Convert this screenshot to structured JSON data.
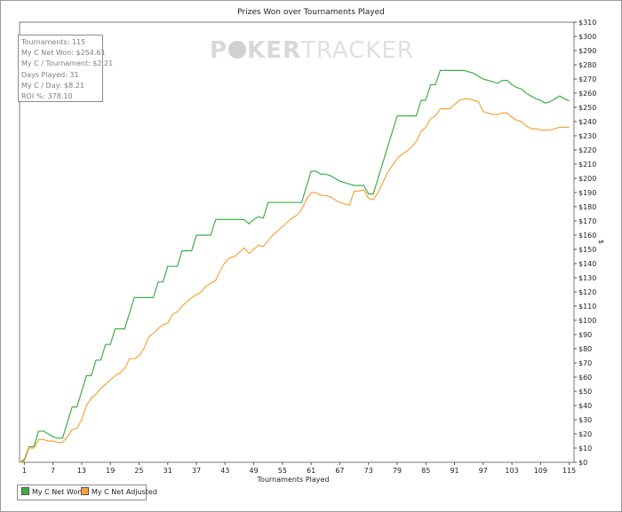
{
  "chart_data": {
    "type": "line",
    "title": "Prizes Won over Tournaments Played",
    "xlabel": "Tournaments Played",
    "ylabel": "$",
    "xlim": [
      0,
      116
    ],
    "ylim": [
      0,
      310
    ],
    "x_ticks": [
      1,
      7,
      13,
      19,
      25,
      31,
      37,
      43,
      49,
      55,
      61,
      67,
      73,
      79,
      85,
      91,
      97,
      103,
      109,
      115
    ],
    "y_ticks_step": 10,
    "y_tick_prefix": "$",
    "y_axis_side": "right",
    "grid": false,
    "legend_position": "bottom-left",
    "series": [
      {
        "name": "My C Net Won",
        "color": "#3fae49",
        "points": [
          [
            0,
            0
          ],
          [
            1,
            2
          ],
          [
            2,
            11
          ],
          [
            3,
            11
          ],
          [
            4,
            22
          ],
          [
            5,
            22
          ],
          [
            6,
            20
          ],
          [
            7,
            18
          ],
          [
            8,
            17
          ],
          [
            9,
            17
          ],
          [
            10,
            28
          ],
          [
            11,
            39
          ],
          [
            12,
            39
          ],
          [
            13,
            50
          ],
          [
            14,
            61
          ],
          [
            15,
            61
          ],
          [
            16,
            72
          ],
          [
            17,
            72
          ],
          [
            18,
            83
          ],
          [
            19,
            83
          ],
          [
            20,
            94
          ],
          [
            21,
            94
          ],
          [
            22,
            94
          ],
          [
            23,
            105
          ],
          [
            24,
            116
          ],
          [
            25,
            116
          ],
          [
            26,
            116
          ],
          [
            27,
            116
          ],
          [
            28,
            116
          ],
          [
            29,
            127
          ],
          [
            30,
            127
          ],
          [
            31,
            138
          ],
          [
            32,
            138
          ],
          [
            33,
            138
          ],
          [
            34,
            149
          ],
          [
            35,
            149
          ],
          [
            36,
            149
          ],
          [
            37,
            160
          ],
          [
            38,
            160
          ],
          [
            39,
            160
          ],
          [
            40,
            160
          ],
          [
            41,
            171
          ],
          [
            42,
            171
          ],
          [
            43,
            171
          ],
          [
            44,
            171
          ],
          [
            45,
            171
          ],
          [
            46,
            171
          ],
          [
            47,
            171
          ],
          [
            48,
            168
          ],
          [
            49,
            171
          ],
          [
            50,
            173
          ],
          [
            51,
            172
          ],
          [
            52,
            183
          ],
          [
            53,
            183
          ],
          [
            54,
            183
          ],
          [
            55,
            183
          ],
          [
            56,
            183
          ],
          [
            57,
            183
          ],
          [
            58,
            183
          ],
          [
            59,
            183
          ],
          [
            60,
            194
          ],
          [
            61,
            205
          ],
          [
            62,
            205
          ],
          [
            63,
            203
          ],
          [
            64,
            203
          ],
          [
            65,
            202
          ],
          [
            66,
            200
          ],
          [
            67,
            198
          ],
          [
            68,
            197
          ],
          [
            69,
            196
          ],
          [
            70,
            195
          ],
          [
            71,
            195
          ],
          [
            72,
            195
          ],
          [
            73,
            189
          ],
          [
            74,
            189
          ],
          [
            75,
            200
          ],
          [
            76,
            211
          ],
          [
            77,
            222
          ],
          [
            78,
            233
          ],
          [
            79,
            244
          ],
          [
            80,
            244
          ],
          [
            81,
            244
          ],
          [
            82,
            244
          ],
          [
            83,
            244
          ],
          [
            84,
            255
          ],
          [
            85,
            255
          ],
          [
            86,
            266
          ],
          [
            87,
            266
          ],
          [
            88,
            276
          ],
          [
            89,
            276
          ],
          [
            90,
            276
          ],
          [
            91,
            276
          ],
          [
            92,
            276
          ],
          [
            93,
            276
          ],
          [
            94,
            275
          ],
          [
            95,
            274
          ],
          [
            96,
            272
          ],
          [
            97,
            270
          ],
          [
            98,
            269
          ],
          [
            99,
            268
          ],
          [
            100,
            267
          ],
          [
            101,
            269
          ],
          [
            102,
            269
          ],
          [
            103,
            266
          ],
          [
            104,
            264
          ],
          [
            105,
            263
          ],
          [
            106,
            260
          ],
          [
            107,
            258
          ],
          [
            108,
            256
          ],
          [
            109,
            255
          ],
          [
            110,
            253
          ],
          [
            111,
            254
          ],
          [
            112,
            256
          ],
          [
            113,
            258
          ],
          [
            114,
            256
          ],
          [
            115,
            254.61
          ]
        ]
      },
      {
        "name": "My C Net Adjusted",
        "color": "#f5a53b",
        "points": [
          [
            0,
            0
          ],
          [
            1,
            1
          ],
          [
            2,
            10
          ],
          [
            3,
            10
          ],
          [
            4,
            16
          ],
          [
            5,
            16
          ],
          [
            6,
            15
          ],
          [
            7,
            15
          ],
          [
            8,
            14
          ],
          [
            9,
            14
          ],
          [
            10,
            18
          ],
          [
            11,
            23
          ],
          [
            12,
            24
          ],
          [
            13,
            30
          ],
          [
            14,
            40
          ],
          [
            15,
            45
          ],
          [
            16,
            48
          ],
          [
            17,
            52
          ],
          [
            18,
            55
          ],
          [
            19,
            58
          ],
          [
            20,
            61
          ],
          [
            21,
            63
          ],
          [
            22,
            66
          ],
          [
            23,
            73
          ],
          [
            24,
            73
          ],
          [
            25,
            75
          ],
          [
            26,
            80
          ],
          [
            27,
            88
          ],
          [
            28,
            91
          ],
          [
            29,
            94
          ],
          [
            30,
            97
          ],
          [
            31,
            98
          ],
          [
            32,
            104
          ],
          [
            33,
            106
          ],
          [
            34,
            110
          ],
          [
            35,
            113
          ],
          [
            36,
            116
          ],
          [
            37,
            118
          ],
          [
            38,
            120
          ],
          [
            39,
            124
          ],
          [
            40,
            126
          ],
          [
            41,
            128
          ],
          [
            42,
            135
          ],
          [
            43,
            141
          ],
          [
            44,
            144
          ],
          [
            45,
            145
          ],
          [
            46,
            148
          ],
          [
            47,
            151
          ],
          [
            48,
            147
          ],
          [
            49,
            150
          ],
          [
            50,
            153
          ],
          [
            51,
            152
          ],
          [
            52,
            156
          ],
          [
            53,
            160
          ],
          [
            54,
            163
          ],
          [
            55,
            166
          ],
          [
            56,
            169
          ],
          [
            57,
            172
          ],
          [
            58,
            174
          ],
          [
            59,
            178
          ],
          [
            60,
            185
          ],
          [
            61,
            190
          ],
          [
            62,
            190
          ],
          [
            63,
            188
          ],
          [
            64,
            188
          ],
          [
            65,
            187
          ],
          [
            66,
            185
          ],
          [
            67,
            183
          ],
          [
            68,
            182
          ],
          [
            69,
            181
          ],
          [
            70,
            191
          ],
          [
            71,
            191
          ],
          [
            72,
            192
          ],
          [
            73,
            186
          ],
          [
            74,
            185
          ],
          [
            75,
            190
          ],
          [
            76,
            197
          ],
          [
            77,
            204
          ],
          [
            78,
            209
          ],
          [
            79,
            214
          ],
          [
            80,
            217
          ],
          [
            81,
            219
          ],
          [
            82,
            222
          ],
          [
            83,
            226
          ],
          [
            84,
            233
          ],
          [
            85,
            236
          ],
          [
            86,
            242
          ],
          [
            87,
            244
          ],
          [
            88,
            249
          ],
          [
            89,
            249
          ],
          [
            90,
            249
          ],
          [
            91,
            252
          ],
          [
            92,
            255
          ],
          [
            93,
            256
          ],
          [
            94,
            256
          ],
          [
            95,
            255
          ],
          [
            96,
            254
          ],
          [
            97,
            247
          ],
          [
            98,
            246
          ],
          [
            99,
            245
          ],
          [
            100,
            245
          ],
          [
            101,
            246
          ],
          [
            102,
            246
          ],
          [
            103,
            243
          ],
          [
            104,
            241
          ],
          [
            105,
            240
          ],
          [
            106,
            237
          ],
          [
            107,
            235
          ],
          [
            108,
            235
          ],
          [
            109,
            234
          ],
          [
            110,
            234
          ],
          [
            111,
            234
          ],
          [
            112,
            235
          ],
          [
            113,
            236
          ],
          [
            114,
            236
          ],
          [
            115,
            236
          ]
        ]
      }
    ]
  },
  "stats": [
    "Tournaments: 115",
    "My C Net Won: $254.61",
    "My C / Tournament: $2.21",
    "Days Played: 31",
    "My C / Day: $8.21",
    "ROI %: 378.10"
  ],
  "watermark": {
    "part1": "P",
    "part2": "KER",
    "part3": "TRACKER"
  }
}
